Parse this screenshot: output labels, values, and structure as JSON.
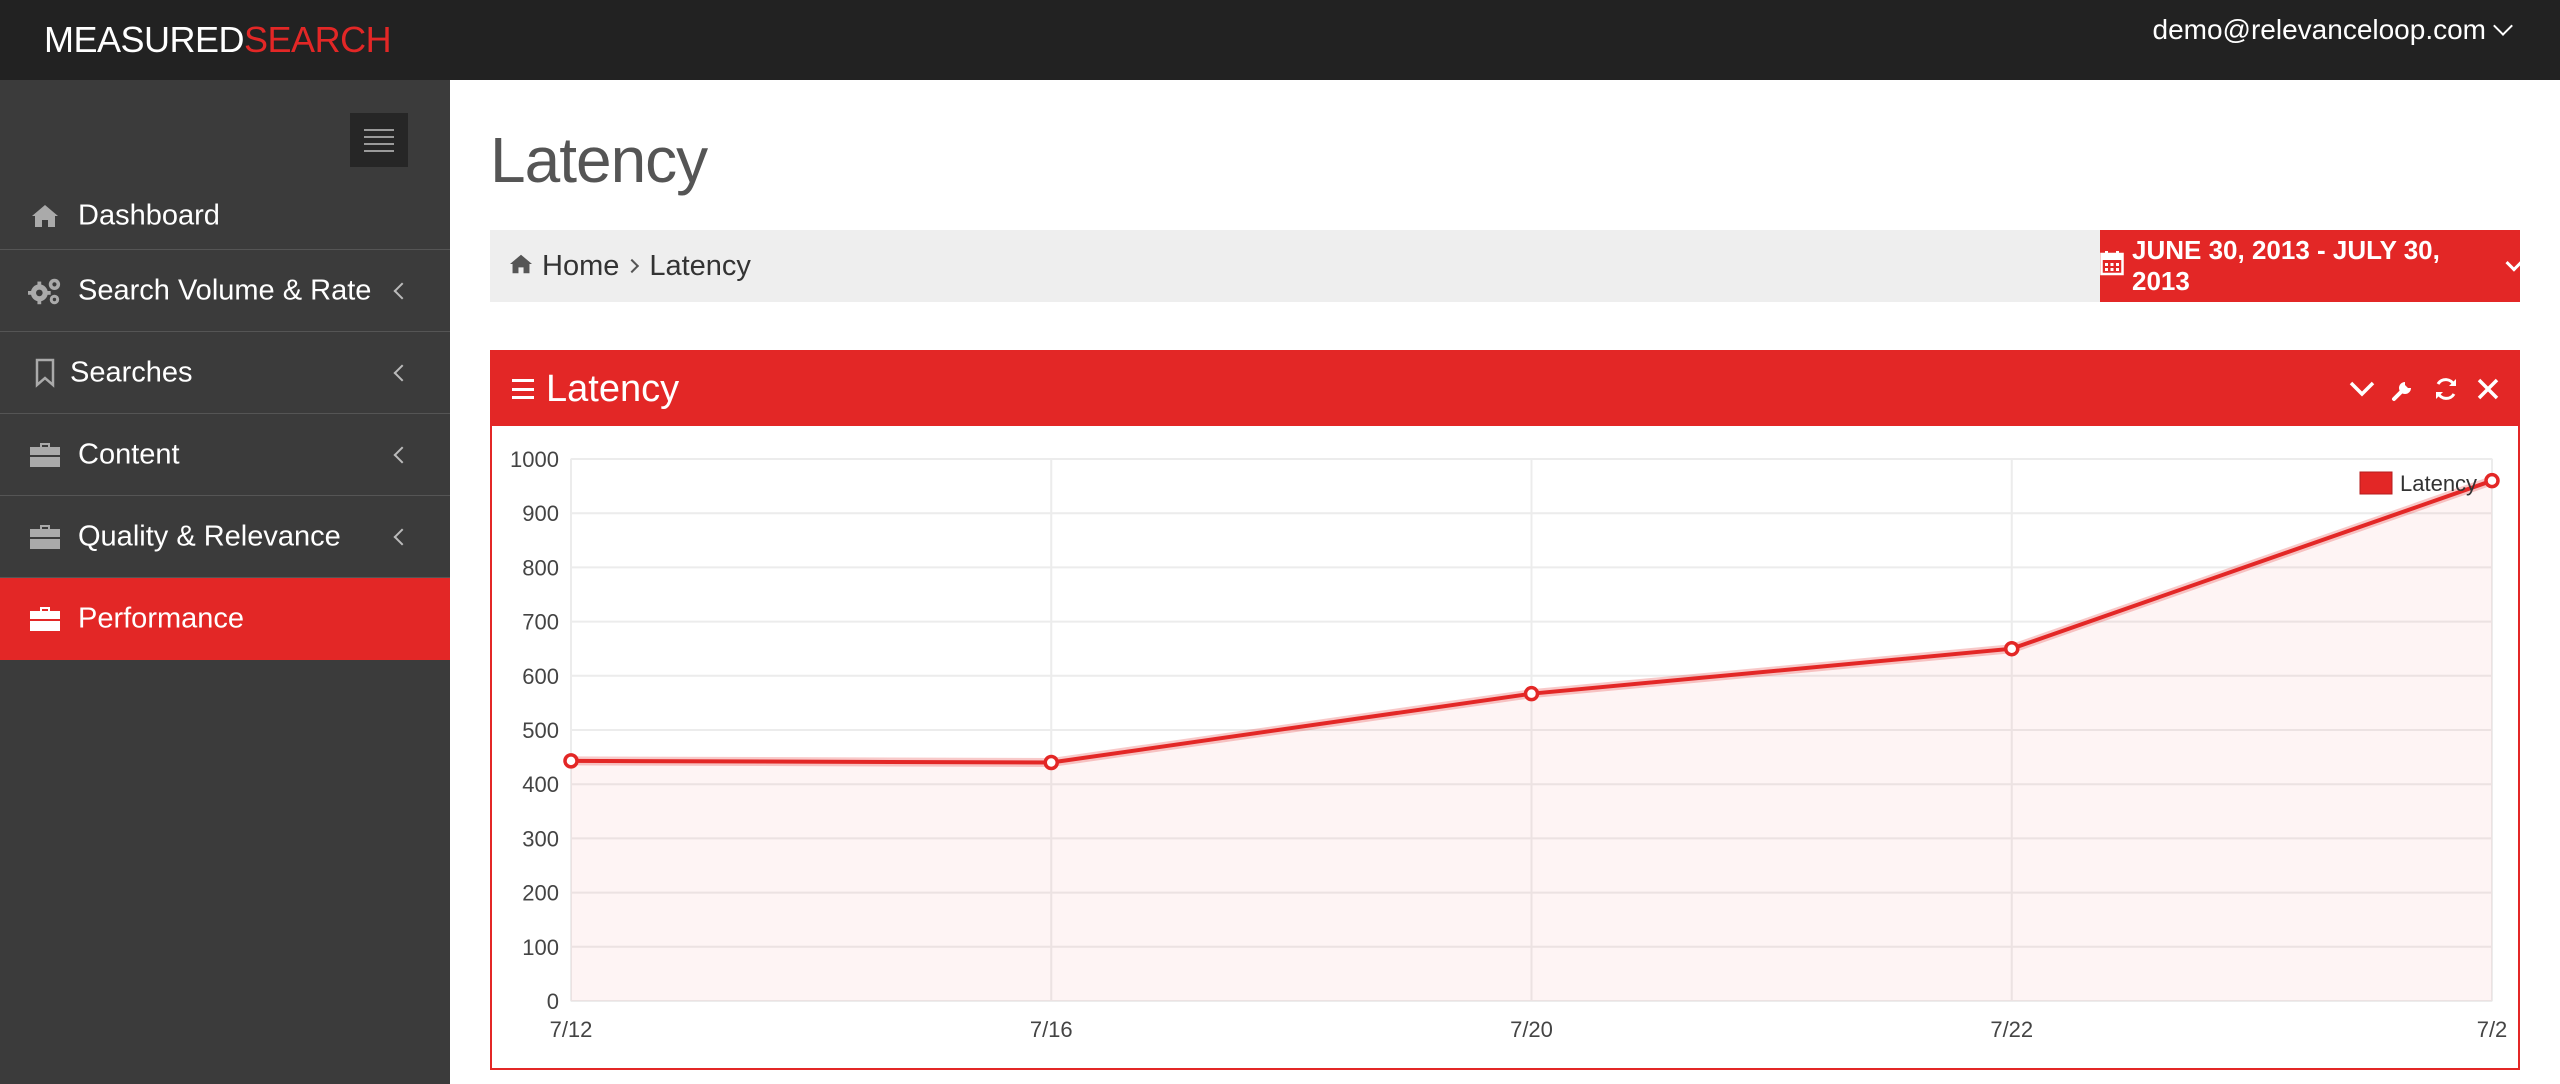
{
  "brand": {
    "part1": "MEASURED",
    "part2": "SEARCH"
  },
  "user": {
    "email": "demo@relevanceloop.com"
  },
  "sidebar": {
    "items": [
      {
        "label": "Dashboard",
        "icon": "home-icon"
      },
      {
        "label": "Search Volume & Rate",
        "icon": "gears-icon"
      },
      {
        "label": "Searches",
        "icon": "bookmark-icon"
      },
      {
        "label": "Content",
        "icon": "briefcase-icon"
      },
      {
        "label": "Quality & Relevance",
        "icon": "briefcase-icon"
      },
      {
        "label": "Performance",
        "icon": "briefcase-icon",
        "active": true
      }
    ]
  },
  "page": {
    "title": "Latency"
  },
  "breadcrumb": {
    "home": "Home",
    "current": "Latency"
  },
  "date_range": {
    "label": "JUNE 30, 2013 - JULY 30, 2013"
  },
  "widget": {
    "title": "Latency"
  },
  "colors": {
    "accent": "#e32726",
    "topbar": "#222222",
    "sidebar": "#3b3b3b"
  },
  "chart_data": {
    "type": "line",
    "x": [
      "7/12",
      "7/16",
      "7/20",
      "7/22",
      "7/2"
    ],
    "series": [
      {
        "name": "Latency",
        "values": [
          443,
          440,
          567,
          650,
          960
        ]
      }
    ],
    "yticks": [
      0,
      100,
      200,
      300,
      400,
      500,
      600,
      700,
      800,
      900,
      1000
    ],
    "ylim": [
      0,
      1000
    ],
    "grid": true,
    "legend": "top-right"
  }
}
